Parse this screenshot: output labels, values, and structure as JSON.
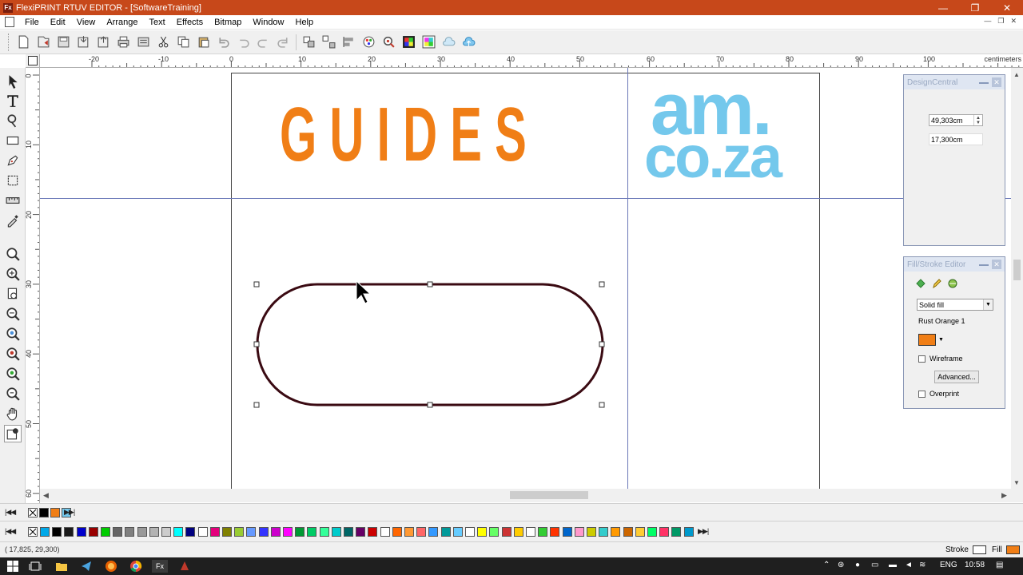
{
  "window": {
    "app_badge": "Fx",
    "title": "FlexiPRINT RTUV EDITOR - [SoftwareTraining]",
    "minimize": "—",
    "maximize": "❐",
    "close": "✕"
  },
  "menu": {
    "items": [
      "File",
      "Edit",
      "View",
      "Arrange",
      "Text",
      "Effects",
      "Bitmap",
      "Window",
      "Help"
    ],
    "mdi_minimize": "—",
    "mdi_restore": "❐",
    "mdi_close": "✕"
  },
  "ruler": {
    "units": "centimeters",
    "h_labels": [
      "-20",
      "-10",
      "0",
      "10",
      "20",
      "30",
      "40",
      "50",
      "60",
      "70",
      "80",
      "90",
      "100"
    ],
    "v_labels": [
      "0",
      "10",
      "20",
      "30",
      "40",
      "50",
      "60"
    ]
  },
  "artwork": {
    "guides_text": "GUIDES",
    "am_line1": "am.",
    "am_line2": "co.za",
    "guides_color": "#f07e16",
    "am_color": "#74c8ec",
    "shape_stroke_color": "#3a0a12"
  },
  "design_central": {
    "title": "DesignCentral",
    "width_value": "49,303cm",
    "height_value": "17,300cm"
  },
  "fill_stroke": {
    "title": "Fill/Stroke Editor",
    "fill_type": "Solid fill",
    "color_name": "Rust Orange 1",
    "color": "#f07e16",
    "wireframe_label": "Wireframe",
    "advanced_label": "Advanced...",
    "overprint_label": "Overprint"
  },
  "palette": {
    "colors": [
      "#00a8e8",
      "#000000",
      "#1a1a1a",
      "#0000cc",
      "#990000",
      "#00cc00",
      "#666666",
      "#808080",
      "#999999",
      "#b3b3b3",
      "#cccccc",
      "#00ffff",
      "#000080",
      "#ffffff",
      "#e4007c",
      "#808000",
      "#99cc33",
      "#6699ff",
      "#3333ff",
      "#cc00cc",
      "#ff00ff",
      "#009933",
      "#00cc66",
      "#33ff99",
      "#00cccc",
      "#006666",
      "#660066",
      "#cc0000",
      "#ffffff",
      "#ff6600",
      "#ff9933",
      "#ff6666",
      "#3399ff",
      "#009999",
      "#66ccff",
      "#ffffff",
      "#ffff00",
      "#66ff66",
      "#cc3333",
      "#ffcc00",
      "#ffffff",
      "#33cc33",
      "#ff3300",
      "#0066cc",
      "#ff99cc",
      "#cccc00",
      "#33cccc",
      "#ff9900",
      "#cc6600",
      "#ffcc33",
      "#00ff66",
      "#ff3366",
      "#009966",
      "#0099cc"
    ],
    "recent_colors": [
      "#000000",
      "#f07e16",
      "#74c8ec"
    ]
  },
  "status": {
    "coords": "( 17,825,   29,300)",
    "stroke_label": "Stroke",
    "fill_label": "Fill"
  },
  "taskbar": {
    "fx_label": "Fx",
    "lang": "ENG",
    "time": "10:58"
  }
}
